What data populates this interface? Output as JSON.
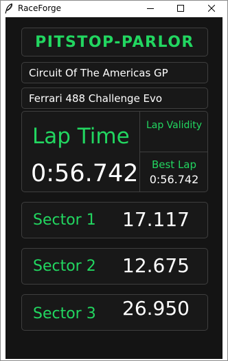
{
  "window": {
    "title": "RaceForge",
    "icon": "feather-icon",
    "controls": [
      "minimize-icon",
      "maximize-icon",
      "close-icon"
    ]
  },
  "brand": "PITSTOP-PARLOR",
  "session": {
    "track": "Circuit Of The Americas GP",
    "car": "Ferrari 488 Challenge Evo"
  },
  "lap": {
    "title": "Lap Time",
    "value": "0:56.742",
    "validity_label": "Lap Validity",
    "best_label": "Best Lap",
    "best_value": "0:56.742"
  },
  "sectors": [
    {
      "label": "Sector 1",
      "value": "17.117"
    },
    {
      "label": "Sector 2",
      "value": "12.675"
    },
    {
      "label": "Sector 3",
      "value": "26.950"
    }
  ],
  "colors": {
    "accent": "#22d660",
    "background": "#141414",
    "panel": "#181818",
    "border": "#3f3f3f",
    "text": "#ffffff"
  }
}
